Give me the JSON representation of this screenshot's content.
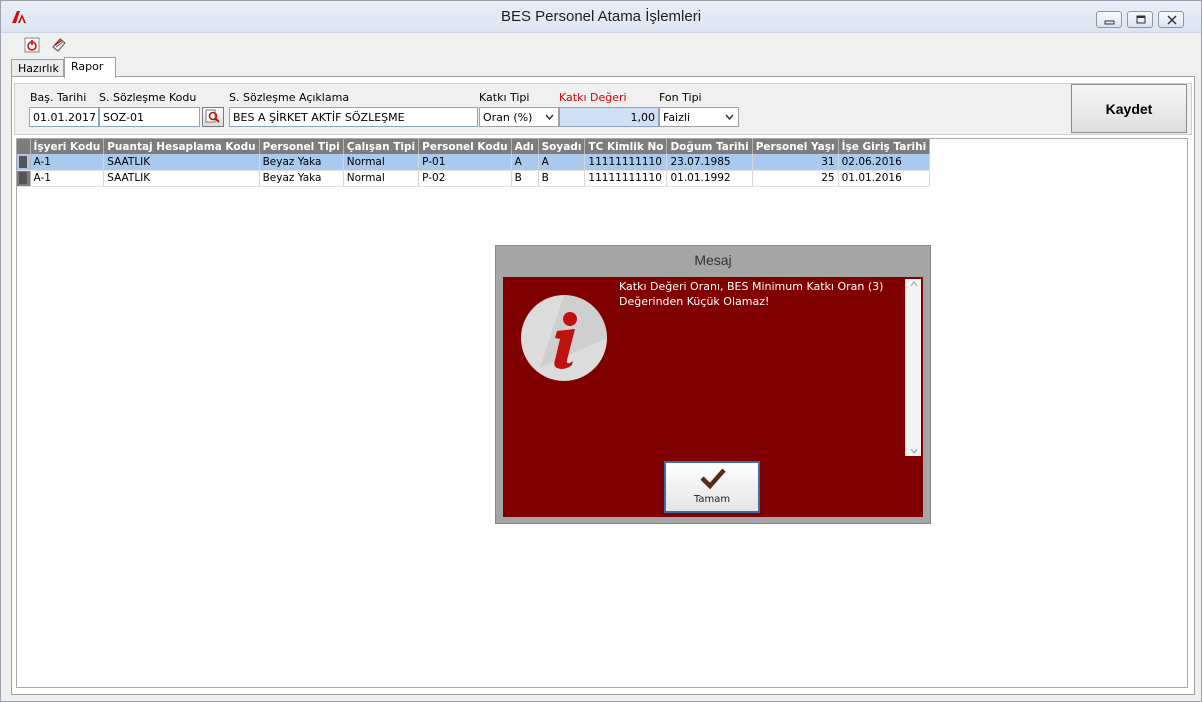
{
  "window": {
    "title": "BES Personel Atama İşlemleri"
  },
  "tabs": [
    {
      "label": "Hazırlık"
    },
    {
      "label": "Rapor"
    }
  ],
  "form": {
    "bas_tarihi_label": "Baş. Tarihi",
    "bas_tarihi_value": "01.01.2017",
    "sozlesme_kodu_label": "S. Sözleşme Kodu",
    "sozlesme_kodu_value": "SOZ-01",
    "sozlesme_aciklama_label": "S. Sözleşme Açıklama",
    "sozlesme_aciklama_value": "BES A ŞİRKET AKTİF SÖZLEŞME",
    "katki_tipi_label": "Katkı Tipi",
    "katki_tipi_value": "Oran (%)",
    "katki_degeri_label": "Katkı Değeri",
    "katki_degeri_value": "1,00",
    "fon_tipi_label": "Fon Tipi",
    "fon_tipi_value": "Faizli",
    "save_label": "Kaydet",
    "highlight_color": "#d40000"
  },
  "grid": {
    "columns": [
      "İşyeri Kodu",
      "Puantaj Hesaplama Kodu",
      "Personel Tipi",
      "Çalışan Tipi",
      "Personel Kodu",
      "Adı",
      "Soyadı",
      "TC Kimlik No",
      "Doğum Tarihi",
      "Personel Yaşı",
      "İşe Giriş Tarihi"
    ],
    "rows": [
      [
        "A-1",
        "SAATLIK",
        "Beyaz Yaka",
        "Normal",
        "P-01",
        "A",
        "A",
        "11111111110",
        "23.07.1985",
        "31",
        "02.06.2016"
      ],
      [
        "A-1",
        "SAATLIK",
        "Beyaz Yaka",
        "Normal",
        "P-02",
        "B",
        "B",
        "11111111110",
        "01.01.1992",
        "25",
        "01.01.2016"
      ]
    ],
    "selected_row": 0
  },
  "dialog": {
    "title": "Mesaj",
    "message_line1": "Katkı Değeri Oranı, BES Minimum Katkı Oran (3)",
    "message_line2": "Değerinden Küçük Olamaz!",
    "ok_label": "Tamam",
    "body_color": "#800000",
    "icon": "info-icon"
  }
}
